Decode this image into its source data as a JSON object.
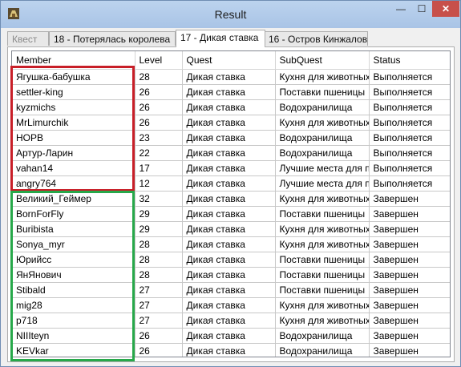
{
  "window": {
    "title": "Result",
    "minimize_glyph": "—",
    "maximize_glyph": "☐",
    "close_glyph": "✕"
  },
  "tabs": [
    {
      "label": "Квест",
      "state": "disabled"
    },
    {
      "label": "18 - Потерялась королева",
      "state": "normal"
    },
    {
      "label": "17 - Дикая ставка",
      "state": "active"
    },
    {
      "label": "16 - Остров Кинжалов",
      "state": "normal"
    }
  ],
  "table": {
    "columns": [
      "Member",
      "Level",
      "Quest",
      "SubQuest",
      "Status"
    ],
    "rows": [
      [
        "Ягушка-бабушка",
        "28",
        "Дикая ставка",
        "Кухня для животных",
        "Выполняется"
      ],
      [
        "settler-king",
        "26",
        "Дикая ставка",
        "Поставки пшеницы",
        "Выполняется"
      ],
      [
        "kyzmichs",
        "26",
        "Дикая ставка",
        "Водохранилища",
        "Выполняется"
      ],
      [
        "MrLimurchik",
        "26",
        "Дикая ставка",
        "Кухня для животных",
        "Выполняется"
      ],
      [
        "НОРВ",
        "23",
        "Дикая ставка",
        "Водохранилища",
        "Выполняется"
      ],
      [
        "Артур-Ларин",
        "22",
        "Дикая ставка",
        "Водохранилища",
        "Выполняется"
      ],
      [
        "vahan14",
        "17",
        "Дикая ставка",
        "Лучшие места для пр",
        "Выполняется"
      ],
      [
        "angry764",
        "12",
        "Дикая ставка",
        "Лучшие места для пр",
        "Выполняется"
      ],
      [
        "Великий_Геймер",
        "32",
        "Дикая ставка",
        "Кухня для животных",
        "Завершен"
      ],
      [
        "BornForFly",
        "29",
        "Дикая ставка",
        "Поставки пшеницы",
        "Завершен"
      ],
      [
        "Buribista",
        "29",
        "Дикая ставка",
        "Кухня для животных",
        "Завершен"
      ],
      [
        "Sonya_myr",
        "28",
        "Дикая ставка",
        "Кухня для животных",
        "Завершен"
      ],
      [
        "Юрийсс",
        "28",
        "Дикая ставка",
        "Поставки пшеницы",
        "Завершен"
      ],
      [
        "ЯнЯнович",
        "28",
        "Дикая ставка",
        "Поставки пшеницы",
        "Завершен"
      ],
      [
        "Stibald",
        "27",
        "Дикая ставка",
        "Поставки пшеницы",
        "Завершен"
      ],
      [
        "mig28",
        "27",
        "Дикая ставка",
        "Кухня для животных",
        "Завершен"
      ],
      [
        "p718",
        "27",
        "Дикая ставка",
        "Кухня для животных",
        "Завершен"
      ],
      [
        "NIIIteyn",
        "26",
        "Дикая ставка",
        "Водохранилища",
        "Завершен"
      ],
      [
        "KEVkar",
        "26",
        "Дикая ставка",
        "Водохранилища",
        "Завершен"
      ]
    ]
  },
  "colors": {
    "highlight_in_progress": "#c81f28",
    "highlight_completed": "#27a84a",
    "close_button": "#c7504a"
  }
}
